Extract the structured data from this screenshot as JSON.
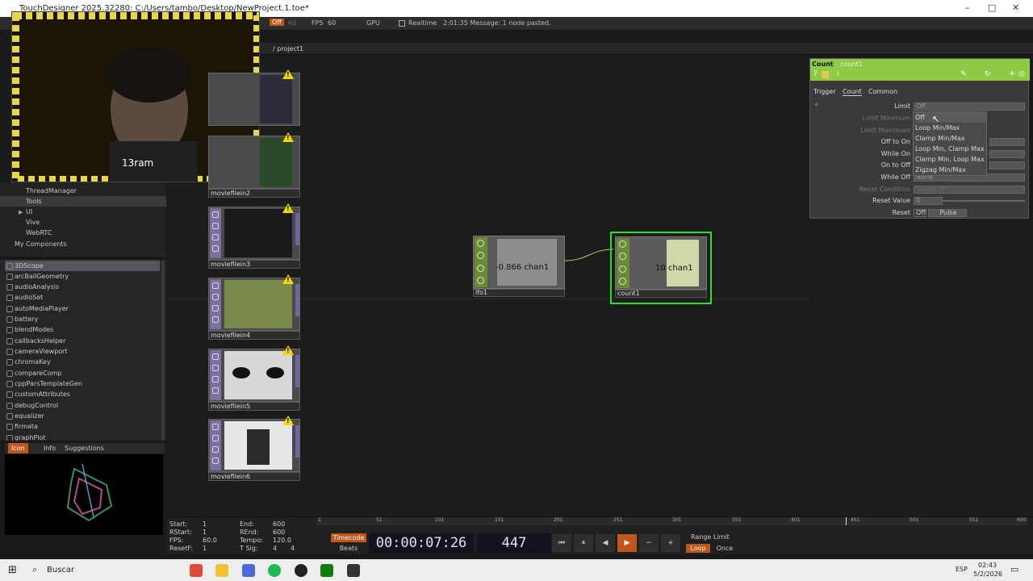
{
  "window": {
    "title": "TouchDesigner 2025.32280: C:/Users/tambo/Desktop/NewProject.1.toe*",
    "minimize": "–",
    "maximize": "□",
    "close": "✕"
  },
  "topbar": {
    "off": "Off",
    "sixty": "60",
    "fps_label": "FPS",
    "fps": "60",
    "gpu": "GPU",
    "realtime": "Realtime",
    "message": "2:01:35 Message: 1 node pasted."
  },
  "path": {
    "text": "/ project1"
  },
  "webcam": {
    "overlay": "13ram"
  },
  "sidebar": {
    "items": [
      {
        "label": "ThreadManager"
      },
      {
        "label": "Tools"
      },
      {
        "label": "UI"
      },
      {
        "label": "Vive"
      },
      {
        "label": "WebRTC"
      },
      {
        "label": "My Components"
      }
    ],
    "list": [
      "3DScope",
      "arcBallGeometry",
      "audioAnalysis",
      "audioSet",
      "autoMediaPlayer",
      "battery",
      "blendModes",
      "callbacksHelper",
      "cameraViewport",
      "chromaKey",
      "compareComp",
      "cppParsTemplateGen",
      "customAttributes",
      "debugControl",
      "equalizer",
      "firmata",
      "graphPlot"
    ],
    "preview_tabs": [
      "Icon",
      "Info",
      "Suggestions"
    ]
  },
  "nodes": [
    {
      "name": "moviefilein2"
    },
    {
      "name": "moviefilein3"
    },
    {
      "name": "moviefilein4"
    },
    {
      "name": "moviefilein5"
    },
    {
      "name": "moviefilein6"
    }
  ],
  "chops": [
    {
      "name": "lfo1",
      "value": "-0.866 chan1"
    },
    {
      "name": "count1",
      "value": "10 chan1"
    }
  ],
  "params": {
    "op_type": "Count",
    "op_name": "count1",
    "tabs": [
      "Trigger",
      "Count",
      "Common"
    ],
    "rows": [
      {
        "label": "Limit",
        "value": "Off"
      },
      {
        "label": "Limit Minimum",
        "value": ""
      },
      {
        "label": "Limit Maximum",
        "value": ""
      },
      {
        "label": "Off to On",
        "value": ""
      },
      {
        "label": "While On",
        "value": ""
      },
      {
        "label": "On to Off",
        "value": ""
      },
      {
        "label": "While Off",
        "value": "None"
      },
      {
        "label": "Reset Condition",
        "value": "Toggle Off"
      },
      {
        "label": "Reset Value",
        "value": "0"
      },
      {
        "label": "Reset",
        "value": "Off"
      }
    ],
    "pulse": "Pulse",
    "dropdown": [
      "Off",
      "Loop Min/Max",
      "Clamp Min/Max",
      "Loop Min, Clamp Max",
      "Clamp Min, Loop Max",
      "Zigzag Min/Max"
    ]
  },
  "timeline": {
    "ticks": [
      "1",
      "51",
      "101",
      "151",
      "201",
      "251",
      "301",
      "351",
      "401",
      "451",
      "501",
      "551",
      "600"
    ],
    "start_label": "Start:",
    "start": "1",
    "rstart_label": "RStart:",
    "rstart": "1",
    "fps_label": "FPS:",
    "fps": "60.0",
    "resetf_label": "ResetF:",
    "resetf": "1",
    "end_label": "End:",
    "end": "600",
    "rend_label": "REnd:",
    "rend": "600",
    "tempo_label": "Tempo:",
    "tempo": "120.0",
    "tsig_label": "T Sig:",
    "tsig_a": "4",
    "tsig_b": "4",
    "timecode_btn": "Timecode",
    "beats_btn": "Beats",
    "timecode": "00:00:07:26",
    "frame": "447",
    "range_limit": "Range Limit",
    "loop": "Loop",
    "once": "Once"
  },
  "taskbar": {
    "search": "Buscar",
    "lang": "ESP",
    "time": "02:43",
    "date": "5/2/2026"
  }
}
